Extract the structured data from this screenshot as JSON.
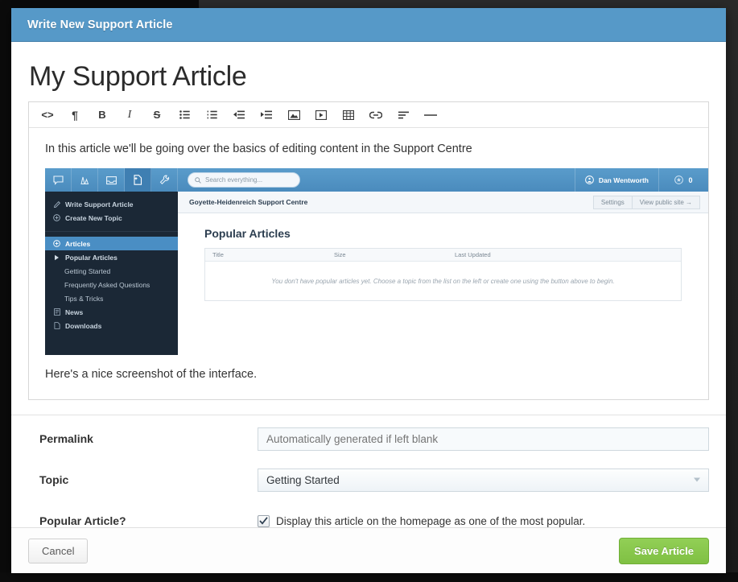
{
  "window": {
    "header_title": "Write New Support Article"
  },
  "article": {
    "title": "My Support Article",
    "paragraph_1": "In this article we'll be going over the basics of editing content in the Support Centre",
    "paragraph_2": "Here's a nice screenshot of the interface."
  },
  "toolbar": {
    "buttons": [
      {
        "name": "source-code-icon",
        "glyph": "<>",
        "label": "Source code"
      },
      {
        "name": "paragraph-icon",
        "glyph": "¶",
        "label": "Paragraph"
      },
      {
        "name": "bold-icon",
        "glyph": "B",
        "label": "Bold"
      },
      {
        "name": "italic-icon",
        "glyph": "I",
        "label": "Italic"
      },
      {
        "name": "strikethrough-icon",
        "glyph": "S",
        "label": "Strikethrough"
      },
      {
        "name": "unordered-list-icon",
        "glyph": "",
        "label": "Bulleted list"
      },
      {
        "name": "ordered-list-icon",
        "glyph": "",
        "label": "Numbered list"
      },
      {
        "name": "outdent-icon",
        "glyph": "",
        "label": "Outdent"
      },
      {
        "name": "indent-icon",
        "glyph": "",
        "label": "Indent"
      },
      {
        "name": "image-icon",
        "glyph": "",
        "label": "Insert image"
      },
      {
        "name": "video-icon",
        "glyph": "",
        "label": "Insert video"
      },
      {
        "name": "table-icon",
        "glyph": "",
        "label": "Insert table"
      },
      {
        "name": "link-icon",
        "glyph": "",
        "label": "Insert link"
      },
      {
        "name": "align-left-icon",
        "glyph": "",
        "label": "Align left"
      },
      {
        "name": "horizontal-rule-icon",
        "glyph": "—",
        "label": "Horizontal rule"
      }
    ]
  },
  "embedded_screenshot": {
    "nav_icons": [
      {
        "name": "chat-bubble-icon",
        "active": false
      },
      {
        "name": "analytics-chart-icon",
        "active": false
      },
      {
        "name": "inbox-icon",
        "active": false
      },
      {
        "name": "new-document-icon",
        "active": true
      },
      {
        "name": "wrench-icon",
        "active": false
      }
    ],
    "search_placeholder": "Search everything...",
    "user_name": "Dan Wentworth",
    "score": "0",
    "breadcrumb": "Goyette-Heidenreich Support Centre",
    "actions": [
      "Settings",
      "View public site →"
    ],
    "sidebar": {
      "group_1": [
        {
          "label": "Write Support Article",
          "icon": "pencil-icon"
        },
        {
          "label": "Create New Topic",
          "icon": "plus-circle-icon"
        }
      ],
      "group_2": [
        {
          "label": "Articles",
          "icon": "plus-circle-icon",
          "selected": true,
          "level": 0
        },
        {
          "label": "Popular Articles",
          "icon": "caret-right-icon",
          "selected": false,
          "level": 1
        },
        {
          "label": "Getting Started",
          "icon": "",
          "selected": false,
          "level": 2
        },
        {
          "label": "Frequently Asked Questions",
          "icon": "",
          "selected": false,
          "level": 2
        },
        {
          "label": "Tips & Tricks",
          "icon": "",
          "selected": false,
          "level": 2
        },
        {
          "label": "News",
          "icon": "news-icon",
          "selected": false,
          "level": 0
        },
        {
          "label": "Downloads",
          "icon": "file-icon",
          "selected": false,
          "level": 0
        }
      ]
    },
    "page_heading": "Popular Articles",
    "table": {
      "headers": [
        "Title",
        "Size",
        "Last Updated"
      ],
      "empty_message": "You don't have popular articles yet. Choose a topic from the list on the left or create one using the button above to begin."
    }
  },
  "form": {
    "permalink": {
      "label": "Permalink",
      "value": "",
      "placeholder": "Automatically generated if left blank"
    },
    "topic": {
      "label": "Topic",
      "value": "Getting Started"
    },
    "popular": {
      "label": "Popular Article?",
      "checked": true,
      "checkbox_label": "Display this article on the homepage as one of the most popular."
    }
  },
  "footer": {
    "cancel_label": "Cancel",
    "save_label": "Save Article"
  },
  "colors": {
    "header_blue": "#5699c8",
    "save_green": "#7fc043",
    "sidebar_dark": "#1b2836",
    "selected_blue": "#4a8ec4"
  }
}
